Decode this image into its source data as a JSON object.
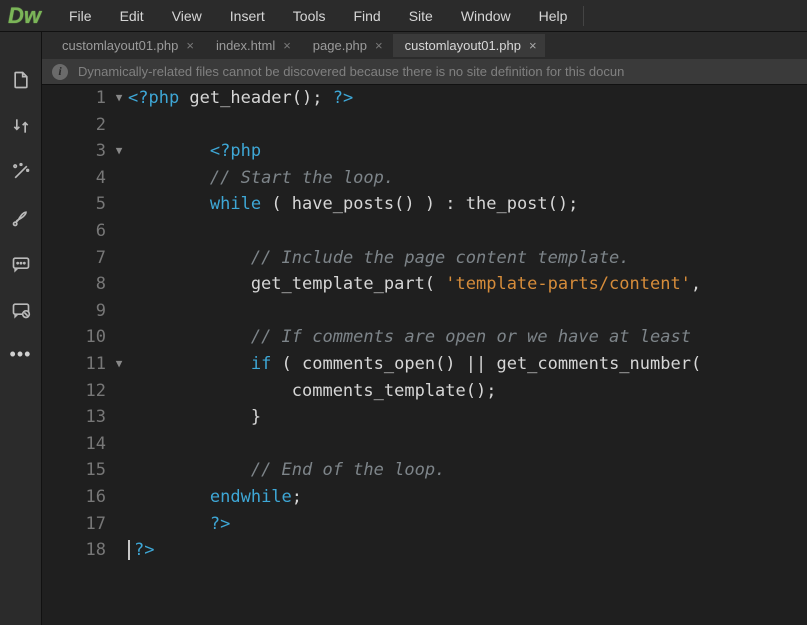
{
  "logo": "Dw",
  "menu": [
    "File",
    "Edit",
    "View",
    "Insert",
    "Tools",
    "Find",
    "Site",
    "Window",
    "Help"
  ],
  "tabs": [
    {
      "label": "customlayout01.php",
      "active": false
    },
    {
      "label": "index.html",
      "active": false
    },
    {
      "label": "page.php",
      "active": false
    },
    {
      "label": "customlayout01.php",
      "active": true
    }
  ],
  "info_bar": "Dynamically-related files cannot be discovered because there is no site definition for this docun",
  "code": {
    "lines": [
      {
        "n": 1,
        "fold": true,
        "segs": [
          {
            "t": "<?php",
            "c": "tok-tag"
          },
          {
            "t": " get_header(); ",
            "c": "tok-func"
          },
          {
            "t": "?>",
            "c": "tok-tag"
          }
        ]
      },
      {
        "n": 2,
        "fold": false,
        "segs": []
      },
      {
        "n": 3,
        "fold": true,
        "segs": [
          {
            "t": "        ",
            "c": ""
          },
          {
            "t": "<?php",
            "c": "tok-tag"
          }
        ]
      },
      {
        "n": 4,
        "fold": false,
        "segs": [
          {
            "t": "        ",
            "c": ""
          },
          {
            "t": "// Start the loop.",
            "c": "tok-comment"
          }
        ]
      },
      {
        "n": 5,
        "fold": false,
        "segs": [
          {
            "t": "        ",
            "c": ""
          },
          {
            "t": "while",
            "c": "tok-keyword"
          },
          {
            "t": " ( have_posts() ) : the_post();",
            "c": "tok-func"
          }
        ]
      },
      {
        "n": 6,
        "fold": false,
        "segs": []
      },
      {
        "n": 7,
        "fold": false,
        "segs": [
          {
            "t": "            ",
            "c": ""
          },
          {
            "t": "// Include the page content template.",
            "c": "tok-comment"
          }
        ]
      },
      {
        "n": 8,
        "fold": false,
        "segs": [
          {
            "t": "            get_template_part( ",
            "c": "tok-func"
          },
          {
            "t": "'template-parts/content'",
            "c": "tok-string"
          },
          {
            "t": ",",
            "c": "tok-func"
          }
        ]
      },
      {
        "n": 9,
        "fold": false,
        "segs": []
      },
      {
        "n": 10,
        "fold": false,
        "segs": [
          {
            "t": "            ",
            "c": ""
          },
          {
            "t": "// If comments are open or we have at least ",
            "c": "tok-comment"
          }
        ]
      },
      {
        "n": 11,
        "fold": true,
        "segs": [
          {
            "t": "            ",
            "c": ""
          },
          {
            "t": "if",
            "c": "tok-keyword"
          },
          {
            "t": " ( comments_open() || get_comments_number(",
            "c": "tok-func"
          }
        ]
      },
      {
        "n": 12,
        "fold": false,
        "segs": [
          {
            "t": "                comments_template();",
            "c": "tok-func"
          }
        ]
      },
      {
        "n": 13,
        "fold": false,
        "segs": [
          {
            "t": "            }",
            "c": "tok-func"
          }
        ]
      },
      {
        "n": 14,
        "fold": false,
        "segs": []
      },
      {
        "n": 15,
        "fold": false,
        "segs": [
          {
            "t": "            ",
            "c": ""
          },
          {
            "t": "// End of the loop.",
            "c": "tok-comment"
          }
        ]
      },
      {
        "n": 16,
        "fold": false,
        "segs": [
          {
            "t": "        ",
            "c": ""
          },
          {
            "t": "endwhile",
            "c": "tok-keyword"
          },
          {
            "t": ";",
            "c": "tok-func"
          }
        ]
      },
      {
        "n": 17,
        "fold": false,
        "segs": [
          {
            "t": "        ",
            "c": ""
          },
          {
            "t": "?>",
            "c": "tok-tag"
          }
        ]
      },
      {
        "n": 18,
        "fold": false,
        "cursor": true,
        "segs": [
          {
            "t": "?>",
            "c": "tok-tag"
          }
        ]
      }
    ]
  }
}
